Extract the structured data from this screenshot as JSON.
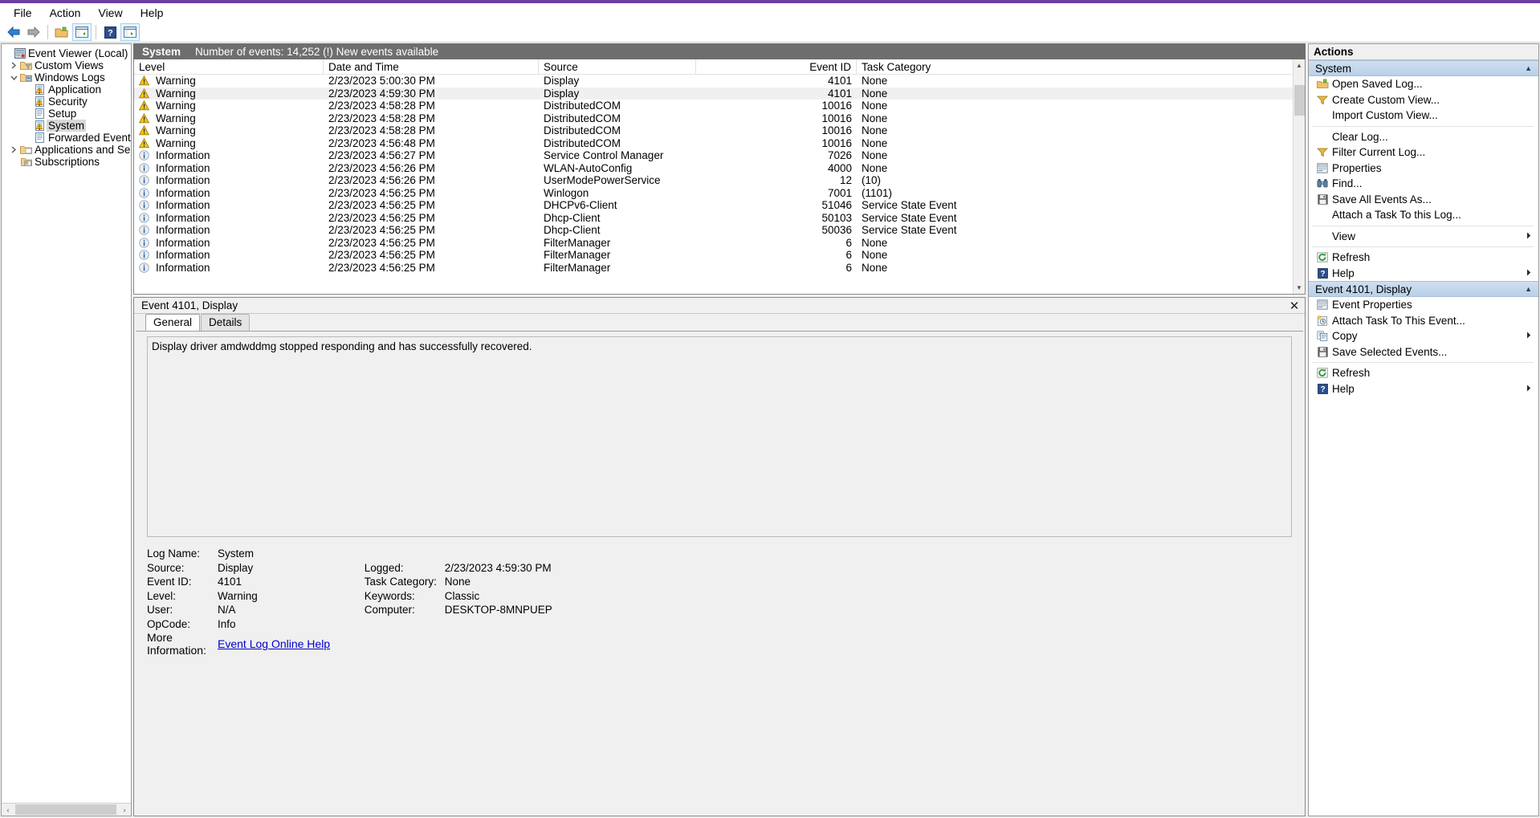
{
  "window": {
    "menu": [
      "File",
      "Action",
      "View",
      "Help"
    ],
    "toolbar_icons": [
      "back-arrow-icon",
      "forward-arrow-icon",
      "show-hide-tree-icon",
      "properties-icon",
      "help-icon",
      "show-hide-action-pane-icon"
    ]
  },
  "tree": {
    "root": {
      "label": "Event Viewer (Local)",
      "icon": "event-viewer-icon"
    },
    "items": [
      {
        "label": "Custom Views",
        "icon": "custom-views-folder-icon",
        "expander": "collapsed",
        "indent": 1,
        "selected": false
      },
      {
        "label": "Windows Logs",
        "icon": "windows-logs-folder-icon",
        "expander": "expanded",
        "indent": 1,
        "selected": false
      },
      {
        "label": "Application",
        "icon": "log-warning-icon",
        "expander": "none",
        "indent": 2,
        "selected": false
      },
      {
        "label": "Security",
        "icon": "log-warning-icon",
        "expander": "none",
        "indent": 2,
        "selected": false
      },
      {
        "label": "Setup",
        "icon": "log-icon",
        "expander": "none",
        "indent": 2,
        "selected": false
      },
      {
        "label": "System",
        "icon": "log-warning-icon",
        "expander": "none",
        "indent": 2,
        "selected": true
      },
      {
        "label": "Forwarded Events",
        "icon": "log-icon",
        "expander": "none",
        "indent": 2,
        "selected": false
      },
      {
        "label": "Applications and Services Lo",
        "icon": "services-folder-icon",
        "expander": "collapsed",
        "indent": 1,
        "selected": false
      },
      {
        "label": "Subscriptions",
        "icon": "subscriptions-icon",
        "expander": "none",
        "indent": 1,
        "selected": false
      }
    ],
    "hscroll": {
      "left_arrow": "‹",
      "right_arrow": "›"
    }
  },
  "list": {
    "caption_name": "System",
    "caption_status": "Number of events: 14,252 (!) New events available",
    "columns": [
      "Level",
      "Date and Time",
      "Source",
      "Event ID",
      "Task Category"
    ],
    "rows": [
      {
        "level": "Warning",
        "icon": "warning-icon",
        "date": "2/23/2023 5:00:30 PM",
        "source": "Display",
        "event_id": "4101",
        "task": "None",
        "selected": false
      },
      {
        "level": "Warning",
        "icon": "warning-icon",
        "date": "2/23/2023 4:59:30 PM",
        "source": "Display",
        "event_id": "4101",
        "task": "None",
        "selected": true
      },
      {
        "level": "Warning",
        "icon": "warning-icon",
        "date": "2/23/2023 4:58:28 PM",
        "source": "DistributedCOM",
        "event_id": "10016",
        "task": "None",
        "selected": false
      },
      {
        "level": "Warning",
        "icon": "warning-icon",
        "date": "2/23/2023 4:58:28 PM",
        "source": "DistributedCOM",
        "event_id": "10016",
        "task": "None",
        "selected": false
      },
      {
        "level": "Warning",
        "icon": "warning-icon",
        "date": "2/23/2023 4:58:28 PM",
        "source": "DistributedCOM",
        "event_id": "10016",
        "task": "None",
        "selected": false
      },
      {
        "level": "Warning",
        "icon": "warning-icon",
        "date": "2/23/2023 4:56:48 PM",
        "source": "DistributedCOM",
        "event_id": "10016",
        "task": "None",
        "selected": false
      },
      {
        "level": "Information",
        "icon": "information-icon",
        "date": "2/23/2023 4:56:27 PM",
        "source": "Service Control Manager",
        "event_id": "7026",
        "task": "None",
        "selected": false
      },
      {
        "level": "Information",
        "icon": "information-icon",
        "date": "2/23/2023 4:56:26 PM",
        "source": "WLAN-AutoConfig",
        "event_id": "4000",
        "task": "None",
        "selected": false
      },
      {
        "level": "Information",
        "icon": "information-icon",
        "date": "2/23/2023 4:56:26 PM",
        "source": "UserModePowerService",
        "event_id": "12",
        "task": "(10)",
        "selected": false
      },
      {
        "level": "Information",
        "icon": "information-icon",
        "date": "2/23/2023 4:56:25 PM",
        "source": "Winlogon",
        "event_id": "7001",
        "task": "(1101)",
        "selected": false
      },
      {
        "level": "Information",
        "icon": "information-icon",
        "date": "2/23/2023 4:56:25 PM",
        "source": "DHCPv6-Client",
        "event_id": "51046",
        "task": "Service State Event",
        "selected": false
      },
      {
        "level": "Information",
        "icon": "information-icon",
        "date": "2/23/2023 4:56:25 PM",
        "source": "Dhcp-Client",
        "event_id": "50103",
        "task": "Service State Event",
        "selected": false
      },
      {
        "level": "Information",
        "icon": "information-icon",
        "date": "2/23/2023 4:56:25 PM",
        "source": "Dhcp-Client",
        "event_id": "50036",
        "task": "Service State Event",
        "selected": false
      },
      {
        "level": "Information",
        "icon": "information-icon",
        "date": "2/23/2023 4:56:25 PM",
        "source": "FilterManager",
        "event_id": "6",
        "task": "None",
        "selected": false
      },
      {
        "level": "Information",
        "icon": "information-icon",
        "date": "2/23/2023 4:56:25 PM",
        "source": "FilterManager",
        "event_id": "6",
        "task": "None",
        "selected": false
      },
      {
        "level": "Information",
        "icon": "information-icon",
        "date": "2/23/2023 4:56:25 PM",
        "source": "FilterManager",
        "event_id": "6",
        "task": "None",
        "selected": false
      }
    ]
  },
  "detail": {
    "title": "Event 4101, Display",
    "close_label": "✕",
    "tabs": [
      {
        "label": "General",
        "active": true
      },
      {
        "label": "Details",
        "active": false
      }
    ],
    "message": "Display driver amdwddmg stopped responding and has successfully recovered.",
    "fields_left": [
      {
        "label": "Log Name:",
        "value": "System"
      },
      {
        "label": "Source:",
        "value": "Display"
      },
      {
        "label": "Event ID:",
        "value": "4101"
      },
      {
        "label": "Level:",
        "value": "Warning"
      },
      {
        "label": "User:",
        "value": "N/A"
      },
      {
        "label": "OpCode:",
        "value": "Info"
      }
    ],
    "fields_right": [
      {
        "label": "Logged:",
        "value": "2/23/2023 4:59:30 PM"
      },
      {
        "label": "Task Category:",
        "value": "None"
      },
      {
        "label": "Keywords:",
        "value": "Classic"
      },
      {
        "label": "Computer:",
        "value": "DESKTOP-8MNPUEP"
      }
    ],
    "more_information_label": "More Information:",
    "more_information_link": "Event Log Online Help"
  },
  "actions": {
    "header": "Actions",
    "sections": [
      {
        "title": "System",
        "collapse_glyph": "▲",
        "items": [
          {
            "label": "Open Saved Log...",
            "icon": "open-folder-icon",
            "submenu": false,
            "sep_after": false
          },
          {
            "label": "Create Custom View...",
            "icon": "filter-icon",
            "submenu": false,
            "sep_after": false
          },
          {
            "label": "Import Custom View...",
            "icon": "none",
            "submenu": false,
            "sep_after": true
          },
          {
            "label": "Clear Log...",
            "icon": "none",
            "submenu": false,
            "sep_after": false
          },
          {
            "label": "Filter Current Log...",
            "icon": "filter-icon",
            "submenu": false,
            "sep_after": false
          },
          {
            "label": "Properties",
            "icon": "properties-icon",
            "submenu": false,
            "sep_after": false
          },
          {
            "label": "Find...",
            "icon": "binoculars-icon",
            "submenu": false,
            "sep_after": false
          },
          {
            "label": "Save All Events As...",
            "icon": "save-icon",
            "submenu": false,
            "sep_after": false
          },
          {
            "label": "Attach a Task To this Log...",
            "icon": "none",
            "submenu": false,
            "sep_after": true
          },
          {
            "label": "View",
            "icon": "none",
            "submenu": true,
            "sep_after": true
          },
          {
            "label": "Refresh",
            "icon": "refresh-icon",
            "submenu": false,
            "sep_after": false
          },
          {
            "label": "Help",
            "icon": "help-icon",
            "submenu": true,
            "sep_after": false
          }
        ]
      },
      {
        "title": "Event 4101, Display",
        "collapse_glyph": "▲",
        "items": [
          {
            "label": "Event Properties",
            "icon": "properties-icon",
            "submenu": false,
            "sep_after": false
          },
          {
            "label": "Attach Task To This Event...",
            "icon": "attach-task-icon",
            "submenu": false,
            "sep_after": false
          },
          {
            "label": "Copy",
            "icon": "copy-icon",
            "submenu": true,
            "sep_after": false
          },
          {
            "label": "Save Selected Events...",
            "icon": "save-icon",
            "submenu": false,
            "sep_after": true
          },
          {
            "label": "Refresh",
            "icon": "refresh-icon",
            "submenu": false,
            "sep_after": false
          },
          {
            "label": "Help",
            "icon": "help-icon",
            "submenu": true,
            "sep_after": false
          }
        ]
      }
    ]
  },
  "colors": {
    "accent_purple": "#6b3fa0",
    "caption_bar": "#6e6e6e",
    "section_header": "#b9d0e8",
    "warning_yellow": "#f5c518",
    "info_blue": "#2a5fa5",
    "link_blue": "#0000cc"
  }
}
